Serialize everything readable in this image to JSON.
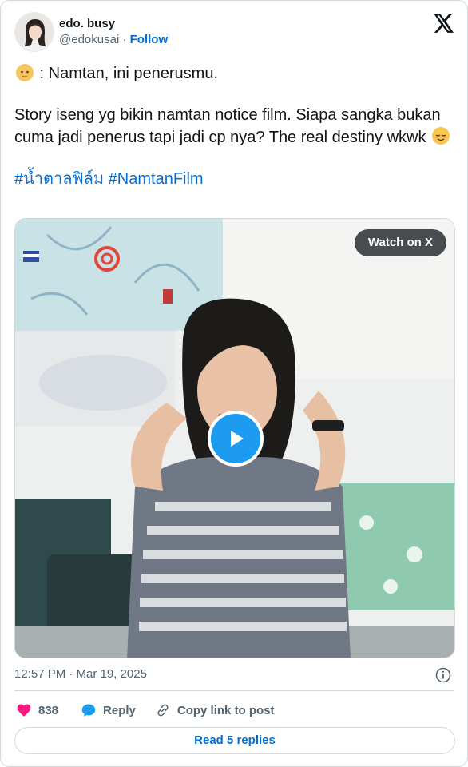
{
  "author": {
    "display_name": "edo. busy",
    "handle": "@edokusai",
    "separator": " · ",
    "follow_label": "Follow"
  },
  "tweet": {
    "line1_text": " : Namtan, ini penerusmu.",
    "line2_text": "Story iseng yg bikin namtan notice film. Siapa sangka bukan cuma jadi penerus tapi jadi cp nya? The real destiny wkwk ",
    "hashtag1": "#น้ำตาลฟิล์ม",
    "hashtag2": "#NamtanFilm",
    "emoji1": "baby-face-emoji",
    "emoji2": "relieved-face-emoji"
  },
  "media": {
    "watch_label": "Watch on X",
    "play_icon": "play-icon"
  },
  "meta": {
    "timestamp": "12:57 PM · Mar 19, 2025"
  },
  "actions": {
    "like_count": "838",
    "reply_label": "Reply",
    "copy_label": "Copy link to post"
  },
  "footer": {
    "read_replies_label": "Read 5 replies"
  },
  "colors": {
    "link_blue": "#006fd6",
    "play_blue": "#1d9bf0",
    "like_pink": "#f91880",
    "muted_gray": "#536471"
  }
}
